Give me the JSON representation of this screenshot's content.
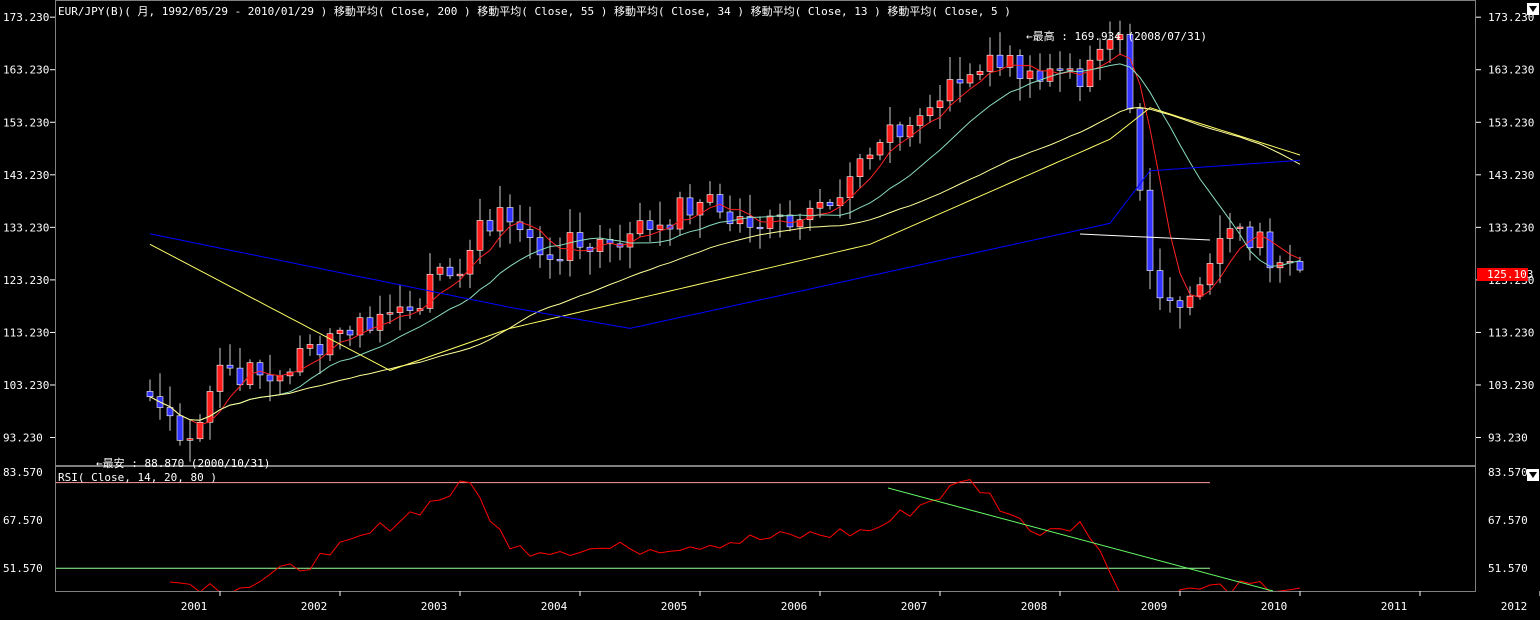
{
  "main_title": "EUR/JPY(B)( 月, 1992/05/29 - 2010/01/29 )  移動平均( Close, 200 )  移動平均( Close, 55 )  移動平均( Close, 34 )  移動平均( Close, 13 )  移動平均( Close, 5 )",
  "rsi_title": "RSI( Close, 14, 20, 80 )",
  "annotations": {
    "high": "←最高 : 169.934 (2008/07/31)",
    "low": "←最安 : 88.870 (2000/10/31)"
  },
  "current_price_label": "125.103",
  "colors": {
    "background": "#000000",
    "up_candle": "#ff1a1a",
    "down_candle": "#3333ff",
    "ma200": "#0000ff",
    "ma55": "#ffff66",
    "ma34": "#ffff99",
    "ma13": "#88ddbb",
    "ma5": "#ff2222",
    "rsi_line": "#ff0000",
    "rsi_80": "#ff9999",
    "rsi_20": "#99ff99",
    "trendline": "#66ff66",
    "price_marker": "#ff0000"
  },
  "chart_data": [
    {
      "type": "candlestick",
      "title": "EUR/JPY(B)( 月, 1992/05/29 - 2010/01/29 )",
      "ylim": [
        88.0,
        176.5
      ],
      "y_ticks": [
        "173.230",
        "163.230",
        "153.230",
        "143.230",
        "133.230",
        "123.230",
        "113.230",
        "103.230",
        "93.230"
      ],
      "x_ticks": [
        "2001",
        "2002",
        "2003",
        "2004",
        "2005",
        "2006",
        "2007",
        "2008",
        "2009",
        "2010",
        "2011",
        "2012"
      ],
      "key_points": [
        {
          "date": "2000-06",
          "close": 101
        },
        {
          "date": "2000-10",
          "close": 93
        },
        {
          "date": "2001-01",
          "close": 107
        },
        {
          "date": "2001-06",
          "close": 104
        },
        {
          "date": "2001-12",
          "close": 113
        },
        {
          "date": "2002-06",
          "close": 117
        },
        {
          "date": "2002-12",
          "close": 124
        },
        {
          "date": "2003-05",
          "close": 137
        },
        {
          "date": "2003-09",
          "close": 128
        },
        {
          "date": "2004-06",
          "close": 132
        },
        {
          "date": "2005-01",
          "close": 138
        },
        {
          "date": "2005-07",
          "close": 133
        },
        {
          "date": "2006-01",
          "close": 138
        },
        {
          "date": "2006-06",
          "close": 147
        },
        {
          "date": "2006-12",
          "close": 156
        },
        {
          "date": "2007-06",
          "close": 166
        },
        {
          "date": "2007-10",
          "close": 163
        },
        {
          "date": "2008-03",
          "close": 160
        },
        {
          "date": "2008-07",
          "close": 169.934
        },
        {
          "date": "2008-10",
          "close": 125
        },
        {
          "date": "2009-01",
          "close": 118
        },
        {
          "date": "2009-06",
          "close": 133
        },
        {
          "date": "2010-01",
          "close": 125.103
        }
      ],
      "series": [
        {
          "name": "移動平均( Close, 200 )"
        },
        {
          "name": "移動平均( Close, 55 )"
        },
        {
          "name": "移動平均( Close, 34 )"
        },
        {
          "name": "移動平均( Close, 13 )"
        },
        {
          "name": "移動平均( Close, 5 )"
        }
      ]
    },
    {
      "type": "line",
      "title": "RSI( Close, 14, 20, 80 )",
      "ylim": [
        44.0,
        85.5
      ],
      "y_ticks": [
        "83.570",
        "67.570",
        "51.570"
      ],
      "levels": [
        80,
        51.57
      ],
      "key_points": [
        {
          "date": "2000-08",
          "value": 47
        },
        {
          "date": "2001-03",
          "value": 45
        },
        {
          "date": "2001-12",
          "value": 56
        },
        {
          "date": "2003-02",
          "value": 80
        },
        {
          "date": "2003-06",
          "value": 58
        },
        {
          "date": "2004-06",
          "value": 58
        },
        {
          "date": "2006-06",
          "value": 64
        },
        {
          "date": "2007-04",
          "value": 81
        },
        {
          "date": "2007-10",
          "value": 64
        },
        {
          "date": "2008-03",
          "value": 67
        },
        {
          "date": "2008-09",
          "value": 35
        },
        {
          "date": "2009-02",
          "value": 45
        },
        {
          "date": "2010-01",
          "value": 45
        }
      ]
    }
  ]
}
